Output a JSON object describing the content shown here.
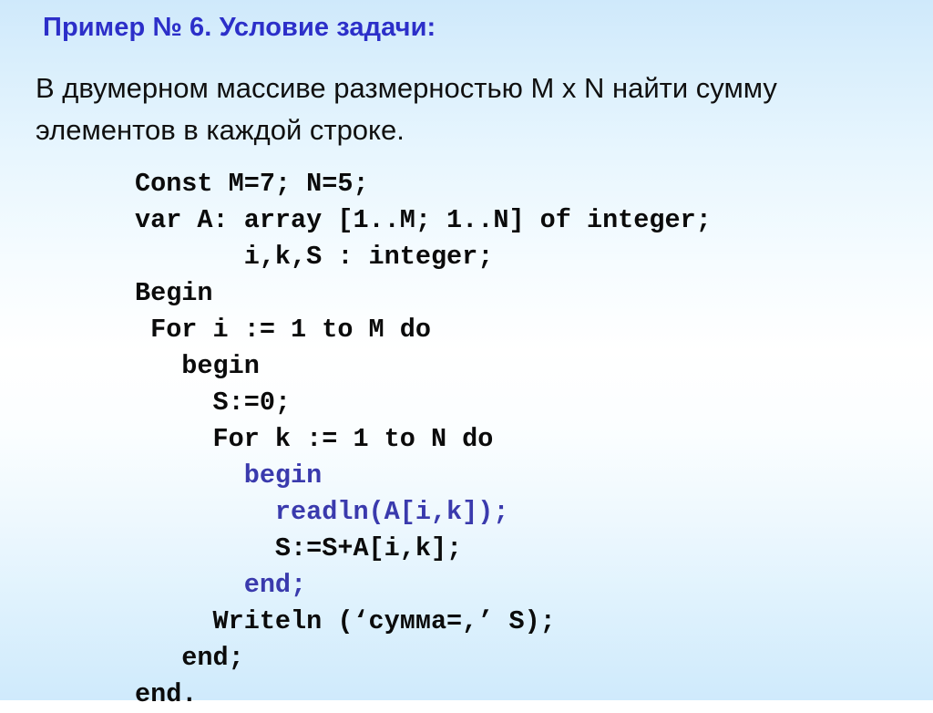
{
  "slide": {
    "title": "Пример № 6. Условие задачи:",
    "statement": "В двумерном массиве размерностью M x N найти сумму элементов в каждой строке.",
    "colors": {
      "title_blue": "#2c2fc9",
      "code_black": "#0b0b0b",
      "code_blue": "#3a3aad",
      "background_top": "#cfe9fb",
      "background_middle": "#ffffff",
      "background_bottom": "#cfeafc"
    },
    "code": {
      "language": "pascal",
      "lines": [
        {
          "text": "Const M=7; N=5;",
          "color": "black"
        },
        {
          "text": "var A: array [1..M; 1..N] of integer;",
          "color": "black"
        },
        {
          "text": "       i,k,S : integer;",
          "color": "black"
        },
        {
          "text": "Begin",
          "color": "black"
        },
        {
          "text": " For i := 1 to M do",
          "color": "black"
        },
        {
          "text": "   begin",
          "color": "black"
        },
        {
          "text": "     S:=0;",
          "color": "black"
        },
        {
          "text": "     For k := 1 to N do",
          "color": "black"
        },
        {
          "text": "       begin",
          "color": "blue"
        },
        {
          "text": "         readln(A[i,k]);",
          "color": "blue"
        },
        {
          "text": "         S:=S+A[i,k];",
          "color": "black"
        },
        {
          "text": "       end;",
          "color": "blue"
        },
        {
          "text": "     Writeln (‘сумма=,’ S);",
          "color": "black"
        },
        {
          "text": "   end;",
          "color": "black"
        },
        {
          "text": "end.",
          "color": "black"
        }
      ]
    }
  }
}
